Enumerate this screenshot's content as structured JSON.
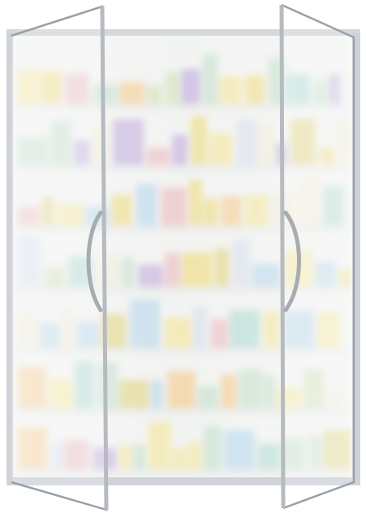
{
  "scene": {
    "subject": "cabinet",
    "colors": {
      "background": "#ffffff",
      "frame": "#c9cdd2",
      "frame_dark": "#9aa0a6",
      "frost": "#f3f5f2",
      "shelf": "#e4e7e5",
      "handle": "#a7acb1"
    },
    "products": {
      "palette": [
        "#e9d46a",
        "#f0e08a",
        "#d9cc6a",
        "#e7b0b6",
        "#a9cfe6",
        "#b8d8c0",
        "#f2c27c",
        "#cfd7e8",
        "#b7a0d6",
        "#9fd3c8",
        "#ece6cf",
        "#c9dba7"
      ]
    },
    "doors": [
      {
        "name": "left-door",
        "state": "open"
      },
      {
        "name": "right-door",
        "state": "open"
      }
    ],
    "shelf_count": 7
  }
}
